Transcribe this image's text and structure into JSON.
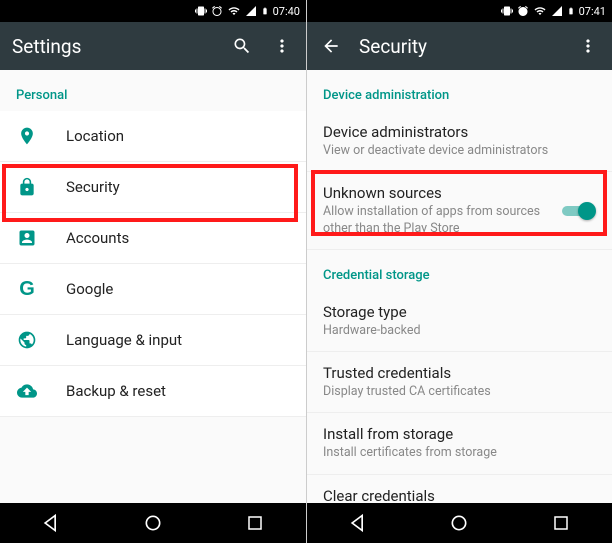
{
  "left": {
    "status_time": "07:40",
    "appbar": {
      "title": "Settings"
    },
    "section": "Personal",
    "items": [
      {
        "label": "Location"
      },
      {
        "label": "Security"
      },
      {
        "label": "Accounts"
      },
      {
        "label": "Google"
      },
      {
        "label": "Language & input"
      },
      {
        "label": "Backup & reset"
      }
    ]
  },
  "right": {
    "status_time": "07:41",
    "appbar": {
      "title": "Security"
    },
    "sections": {
      "device_admin": "Device administration",
      "credential_storage": "Credential storage"
    },
    "items": {
      "device_admins": {
        "title": "Device administrators",
        "sub": "View or deactivate device administrators"
      },
      "unknown_sources": {
        "title": "Unknown sources",
        "sub": "Allow installation of apps from sources other than the Play Store",
        "toggle": true
      },
      "storage_type": {
        "title": "Storage type",
        "sub": "Hardware-backed"
      },
      "trusted_creds": {
        "title": "Trusted credentials",
        "sub": "Display trusted CA certificates"
      },
      "install_storage": {
        "title": "Install from storage",
        "sub": "Install certificates from storage"
      },
      "clear_creds": {
        "title": "Clear credentials"
      }
    }
  }
}
